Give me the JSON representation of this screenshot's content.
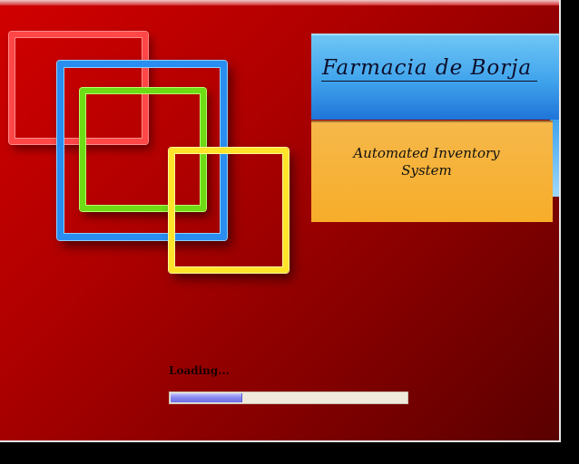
{
  "app": {
    "title": "Farmacia de Borja",
    "subtitle": "Automated Inventory System"
  },
  "loading": {
    "label": "Loading...",
    "progress_fraction": 0.3
  },
  "colors": {
    "background_red": "#b00000",
    "square_red": "#ff4747",
    "square_blue": "#2a8ef0",
    "square_green": "#6edc14",
    "square_yellow": "#ffe42a",
    "title_panel_blue": "#3fa3ec",
    "subtitle_panel_orange": "#f7ad2a",
    "progress_fill": "#8a8af0"
  }
}
